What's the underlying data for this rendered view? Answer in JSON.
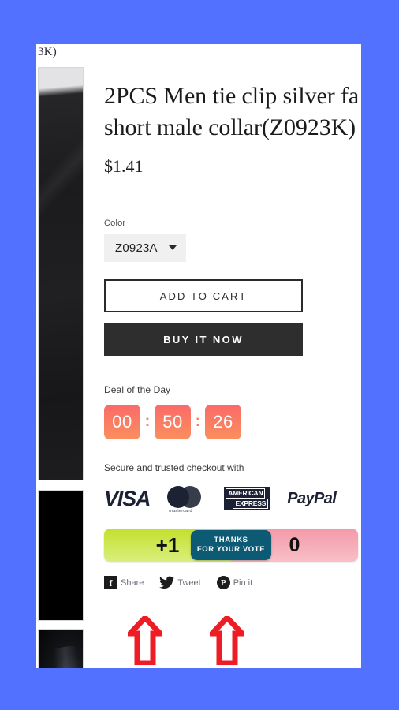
{
  "page": {
    "background_color": "#5271ff",
    "cut_header_text": "3K)"
  },
  "product": {
    "title_line1": "2PCS Men tie clip silver fa",
    "title_line2": "short male collar(Z0923K)",
    "price": "$1.41",
    "color_label": "Color",
    "color_value": "Z0923A",
    "add_to_cart_label": "ADD TO CART",
    "buy_now_label": "BUY IT NOW"
  },
  "deal": {
    "title": "Deal of the Day",
    "hours": "00",
    "minutes": "50",
    "seconds": "26",
    "separator": ":",
    "box_color_top": "#f96a69",
    "box_color_bottom": "#fb8f5e"
  },
  "checkout": {
    "title": "Secure and trusted checkout with",
    "logos": [
      {
        "name": "visa",
        "text": "VISA"
      },
      {
        "name": "mastercard",
        "text": "mastercard"
      },
      {
        "name": "amex",
        "line1": "AMERICAN",
        "line2": "EXPRESS"
      },
      {
        "name": "paypal",
        "text": "PayPal"
      }
    ]
  },
  "vote": {
    "plus_label": "+1",
    "count": "0",
    "tooltip_line1": "THANKS",
    "tooltip_line2": "FOR YOUR VOTE",
    "tooltip_color": "#0c5a73",
    "plus_color": "#c3e02c",
    "count_color": "#f49aa8"
  },
  "share": {
    "facebook_label": "Share",
    "facebook_glyph": "f",
    "twitter_label": "Tweet",
    "pinterest_label": "Pin it",
    "pinterest_glyph": "P"
  },
  "annotations": {
    "arrow_color": "#ee1c25",
    "arrow1_name": "arrow-pointing-to-vote-plus",
    "arrow2_name": "arrow-pointing-to-vote-tooltip"
  }
}
